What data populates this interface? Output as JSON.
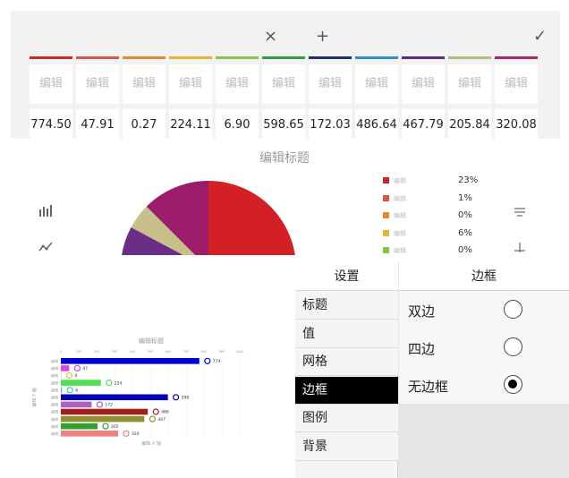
{
  "toolbar": {
    "close_glyph": "×",
    "add_glyph": "+",
    "confirm_glyph": "✓"
  },
  "columns": [
    {
      "label": "编辑",
      "value": "774.50",
      "color": "#c62828"
    },
    {
      "label": "编辑",
      "value": "47.91",
      "color": "#d9534f"
    },
    {
      "label": "编辑",
      "value": "0.27",
      "color": "#e08a2c"
    },
    {
      "label": "编辑",
      "value": "224.11",
      "color": "#e7b43a"
    },
    {
      "label": "编辑",
      "value": "6.90",
      "color": "#8bc34a"
    },
    {
      "label": "编辑",
      "value": "598.65",
      "color": "#2e9e44"
    },
    {
      "label": "编辑",
      "value": "172.03",
      "color": "#1f2f6b"
    },
    {
      "label": "编辑",
      "value": "486.64",
      "color": "#2d8fc9"
    },
    {
      "label": "编辑",
      "value": "467.79",
      "color": "#5b2a7a"
    },
    {
      "label": "编辑",
      "value": "205.84",
      "color": "#b9b97f"
    },
    {
      "label": "编辑",
      "value": "320.08",
      "color": "#a4286a"
    }
  ],
  "chart_data": {
    "type": "pie",
    "title": "编辑标题",
    "legend_position": "right",
    "categories": [
      "编辑",
      "编辑",
      "编辑",
      "编辑",
      "编辑"
    ],
    "legend_values": [
      "23%",
      "1%",
      "0%",
      "6%",
      "0%"
    ],
    "legend_colors": [
      "#c62828",
      "#d9534f",
      "#e08a2c",
      "#e7b43a",
      "#8bc34a"
    ],
    "visible_slices": [
      {
        "color": "#d32027",
        "start_deg": 0,
        "end_deg": 90
      },
      {
        "color": "#9c1c6b",
        "start_deg": 90,
        "end_deg": 135
      },
      {
        "color": "#c7c08a",
        "start_deg": 135,
        "end_deg": 152
      },
      {
        "color": "#6a2e86",
        "start_deg": 152,
        "end_deg": 180
      }
    ]
  },
  "thumbnail": {
    "title": "编辑标题",
    "xlabel": "编辑 X 轴",
    "ylabel": "编辑 Y 轴",
    "ticks": [
      "0",
      "100",
      "200",
      "300",
      "400",
      "500",
      "600",
      "700",
      "800",
      "900",
      "1000"
    ],
    "bars": [
      {
        "label": "编辑",
        "value": 774,
        "text": "774",
        "color": "#0000d0"
      },
      {
        "label": "编辑",
        "value": 47,
        "text": "47",
        "color": "#d946e0"
      },
      {
        "label": "编辑",
        "value": 0,
        "text": "0",
        "color": "#e0c040"
      },
      {
        "label": "编辑",
        "value": 224,
        "text": "224",
        "color": "#50e050"
      },
      {
        "label": "编辑",
        "value": 6,
        "text": "6",
        "color": "#40c0e0"
      },
      {
        "label": "编辑",
        "value": 598,
        "text": "598",
        "color": "#0000b0"
      },
      {
        "label": "编辑",
        "value": 172,
        "text": "172",
        "color": "#b060c0"
      },
      {
        "label": "编辑",
        "value": 486,
        "text": "486",
        "color": "#a02020"
      },
      {
        "label": "编辑",
        "value": 467,
        "text": "467",
        "color": "#909030"
      },
      {
        "label": "编辑",
        "value": 205,
        "text": "205",
        "color": "#30a030"
      },
      {
        "label": "编辑",
        "value": 320,
        "text": "320",
        "color": "#f08080"
      }
    ]
  },
  "settings": {
    "left_header": "设置",
    "right_header": "边框",
    "menu": [
      "标题",
      "值",
      "网格",
      "边框",
      "图例",
      "背景"
    ],
    "active_menu": "边框",
    "options": [
      {
        "label": "双边",
        "selected": false
      },
      {
        "label": "四边",
        "selected": false
      },
      {
        "label": "无边框",
        "selected": true
      }
    ]
  }
}
